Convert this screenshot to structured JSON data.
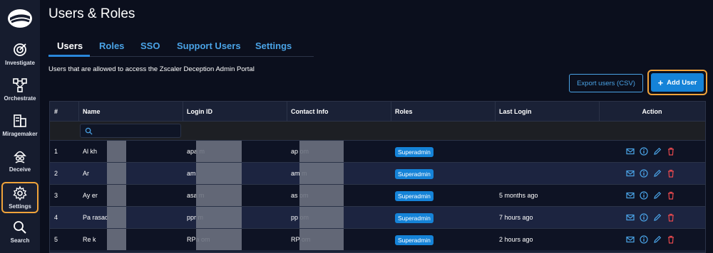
{
  "sidebar": {
    "items": [
      {
        "label": "Investigate",
        "icon": "investigate-icon"
      },
      {
        "label": "Orchestrate",
        "icon": "orchestrate-icon"
      },
      {
        "label": "Miragemaker",
        "icon": "miragemaker-icon"
      },
      {
        "label": "Deceive",
        "icon": "deceive-icon"
      },
      {
        "label": "Settings",
        "icon": "gear-icon",
        "active": true
      },
      {
        "label": "Search",
        "icon": "search-icon"
      }
    ]
  },
  "page": {
    "title": "Users & Roles",
    "description": "Users that are allowed to access the Zscaler Deception Admin Portal"
  },
  "tabs": [
    {
      "label": "Users",
      "active": true
    },
    {
      "label": "Roles"
    },
    {
      "label": "SSO"
    },
    {
      "label": "Support Users"
    },
    {
      "label": "Settings"
    }
  ],
  "toolbar": {
    "export_label": "Export users (CSV)",
    "add_label": "Add User"
  },
  "table": {
    "columns": [
      "#",
      "Name",
      "Login ID",
      "Contact Info",
      "Roles",
      "Last Login",
      "Action"
    ],
    "rows": [
      {
        "num": "1",
        "name": "Al            kh",
        "login": "apa            m",
        "contact": "ap            om",
        "role": "Superadmin",
        "last_login": ""
      },
      {
        "num": "2",
        "name": "Ar",
        "login": "am",
        "contact": "am            m",
        "role": "Superadmin",
        "last_login": ""
      },
      {
        "num": "3",
        "name": "Ay            er",
        "login": "asa            m",
        "contact": "as            om",
        "role": "Superadmin",
        "last_login": "5 months ago"
      },
      {
        "num": "4",
        "name": "Pa            rasad",
        "login": "ppr            m",
        "contact": "pp            om",
        "role": "Superadmin",
        "last_login": "7 hours ago"
      },
      {
        "num": "5",
        "name": "Re            k",
        "login": "RPa            om",
        "contact": "RP            om",
        "role": "Superadmin",
        "last_login": "2 hours ago"
      }
    ]
  },
  "colors": {
    "accent": "#1583d8",
    "link": "#4aa3e6",
    "highlight": "#f0a33a",
    "danger": "#e5484d"
  }
}
